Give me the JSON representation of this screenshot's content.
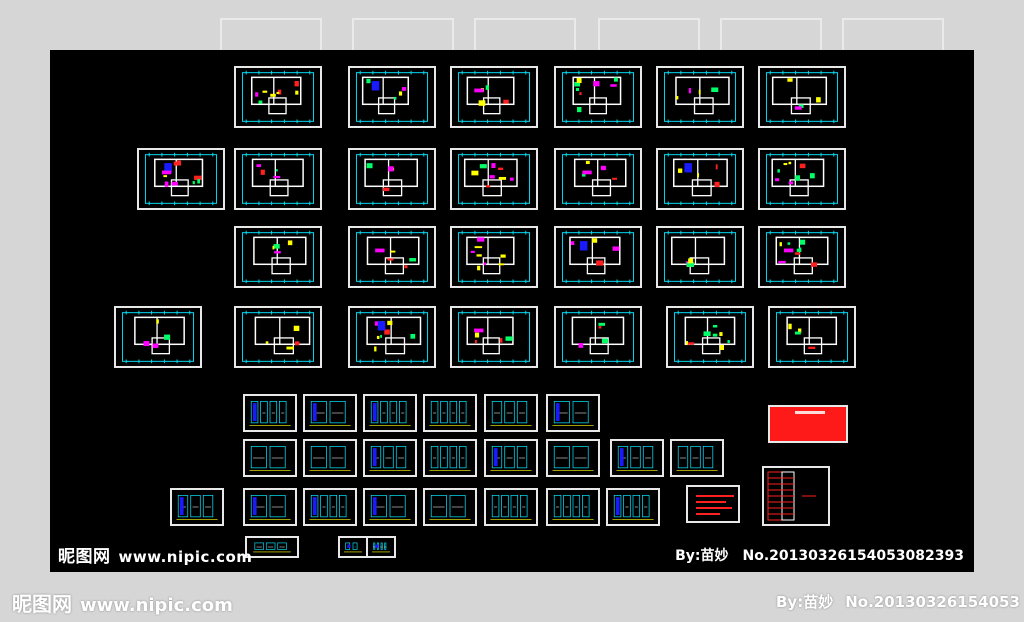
{
  "screen": {
    "kind": "cad-drawing-sheet-overview",
    "background_color": "#d6d6d6",
    "canvas_color": "#000000",
    "sheet_border_color": "#e8e8e8"
  },
  "watermark": {
    "site_name": "昵图网",
    "site_url": "www.nipic.com",
    "author": "By:苗妙",
    "number": "No.20130326154053082393"
  },
  "outer_watermark": {
    "site_name": "昵图网",
    "site_url": "www.nipic.com",
    "author": "By:苗妙",
    "number": "No.20130326154053"
  },
  "palette": {
    "wall": "#ffffff",
    "dimension": "#00e5ff",
    "furniture": "#ffff00",
    "accent_magenta": "#ff00ff",
    "accent_blue": "#1a1aff",
    "accent_green": "#00ff66",
    "accent_red": "#ff2020"
  },
  "icons": {
    "floor_plan": "floor-plan-icon",
    "elevation": "elevation-drawing-icon",
    "legend": "legend-sheet-icon",
    "table": "schedule-table-icon"
  }
}
